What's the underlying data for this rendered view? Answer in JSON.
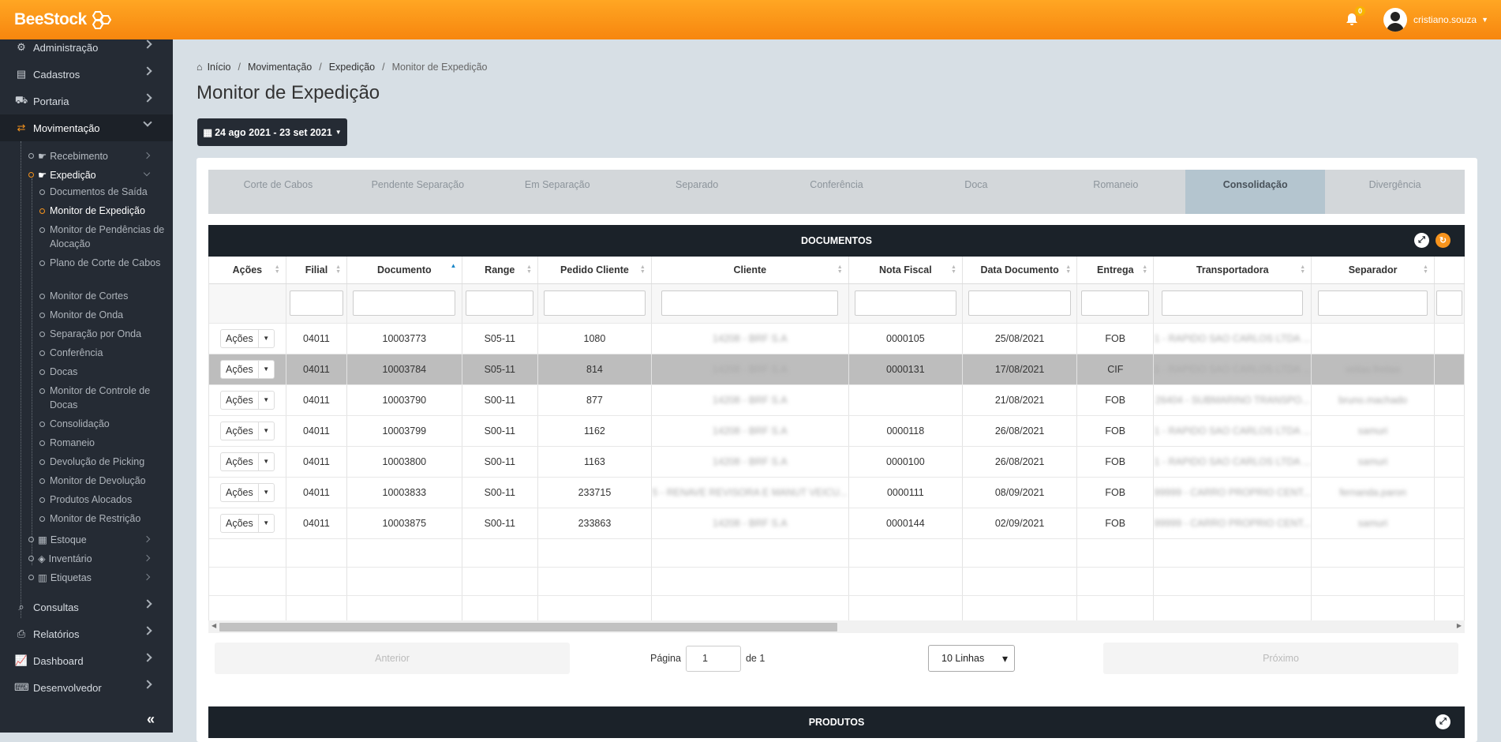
{
  "app": {
    "logo_text": "BeeStock",
    "brand_color": "#f7941d"
  },
  "topbar": {
    "notification_count": "0",
    "username": "cristiano.souza"
  },
  "sidebar": {
    "items": [
      {
        "label": "Administração",
        "icon": "gears-icon"
      },
      {
        "label": "Cadastros",
        "icon": "list-icon"
      },
      {
        "label": "Portaria",
        "icon": "truck-icon"
      },
      {
        "label": "Movimentação",
        "icon": "exchange-icon",
        "active": true
      },
      {
        "label": "Consultas",
        "icon": "search-icon"
      },
      {
        "label": "Relatórios",
        "icon": "print-icon"
      },
      {
        "label": "Dashboard",
        "icon": "chart-icon"
      },
      {
        "label": "Desenvolvedor",
        "icon": "keyboard-icon"
      }
    ],
    "movimentacao_children": [
      {
        "label": "Recebimento"
      },
      {
        "label": "Expedição",
        "open": true
      },
      {
        "label": "Estoque"
      },
      {
        "label": "Inventário"
      },
      {
        "label": "Etiquetas"
      }
    ],
    "expedicao_children": [
      "Documentos de Saída",
      "Monitor de Expedição",
      "Monitor de Pendências de Alocação",
      "Plano de Corte de Cabos",
      "Monitor de Cortes",
      "Monitor de Onda",
      "Separação por Onda",
      "Conferência",
      "Docas",
      "Monitor de Controle de Docas",
      "Consolidação",
      "Romaneio",
      "Devolução de Picking",
      "Monitor de Devolução",
      "Produtos Alocados",
      "Monitor de Restrição"
    ],
    "collapse_label": "«"
  },
  "breadcrumb": [
    "Início",
    "Movimentação",
    "Expedição",
    "Monitor de Expedição"
  ],
  "page_title": "Monitor de Expedição",
  "date_range": "24 ago 2021 - 23 set 2021",
  "tabs": [
    "Corte de Cabos",
    "Pendente Separação",
    "Em Separação",
    "Separado",
    "Conferência",
    "Doca",
    "Romaneio",
    "Consolidação",
    "Divergência"
  ],
  "selected_tab": "Consolidação",
  "documentos": {
    "title": "DOCUMENTOS",
    "columns": [
      "Ações",
      "Filial",
      "Documento",
      "Range",
      "Pedido Cliente",
      "Cliente",
      "Nota Fiscal",
      "Data Documento",
      "Entrega",
      "Transportadora",
      "Separador"
    ],
    "action_label": "Ações",
    "rows": [
      {
        "filial": "04011",
        "documento": "10003773",
        "range": "S05-11",
        "pedido": "1080",
        "cliente": "14208 - BRF S.A",
        "nf": "0000105",
        "data": "25/08/2021",
        "entrega": "FOB",
        "transp": "1 - RAPIDO SAO CARLOS LTDA ...",
        "separador": ""
      },
      {
        "filial": "04011",
        "documento": "10003784",
        "range": "S05-11",
        "pedido": "814",
        "cliente": "14208 - BRF S.A",
        "nf": "0000131",
        "data": "17/08/2021",
        "entrega": "CIF",
        "transp": "1 - RAPIDO SAO CARLOS LTDA ...",
        "separador": "velias.freitas"
      },
      {
        "filial": "04011",
        "documento": "10003790",
        "range": "S00-11",
        "pedido": "877",
        "cliente": "14208 - BRF S.A",
        "nf": "",
        "data": "21/08/2021",
        "entrega": "FOB",
        "transp": "26404 - SUBMARINO TRANSPO...",
        "separador": "bruno.machado"
      },
      {
        "filial": "04011",
        "documento": "10003799",
        "range": "S00-11",
        "pedido": "1162",
        "cliente": "14208 - BRF S.A",
        "nf": "0000118",
        "data": "26/08/2021",
        "entrega": "FOB",
        "transp": "1 - RAPIDO SAO CARLOS LTDA ...",
        "separador": "samuri"
      },
      {
        "filial": "04011",
        "documento": "10003800",
        "range": "S00-11",
        "pedido": "1163",
        "cliente": "14208 - BRF S.A",
        "nf": "0000100",
        "data": "26/08/2021",
        "entrega": "FOB",
        "transp": "1 - RAPIDO SAO CARLOS LTDA ...",
        "separador": "samuri"
      },
      {
        "filial": "04011",
        "documento": "10003833",
        "range": "S00-11",
        "pedido": "233715",
        "cliente": "5 - RENAVE REVISORA E MANUT VEICU...",
        "nf": "0000111",
        "data": "08/09/2021",
        "entrega": "FOB",
        "transp": "99999 - CARRO PROPRIO CENT...",
        "separador": "fernanda.paron"
      },
      {
        "filial": "04011",
        "documento": "10003875",
        "range": "S00-11",
        "pedido": "233863",
        "cliente": "14208 - BRF S.A",
        "nf": "0000144",
        "data": "02/09/2021",
        "entrega": "FOB",
        "transp": "99999 - CARRO PROPRIO CENT...",
        "separador": "samuri"
      }
    ]
  },
  "pager": {
    "prev": "Anterior",
    "next": "Próximo",
    "page_label": "Página",
    "page": "1",
    "of_label": "de 1",
    "rows_option": "10 Linhas"
  },
  "produtos": {
    "title": "PRODUTOS"
  }
}
